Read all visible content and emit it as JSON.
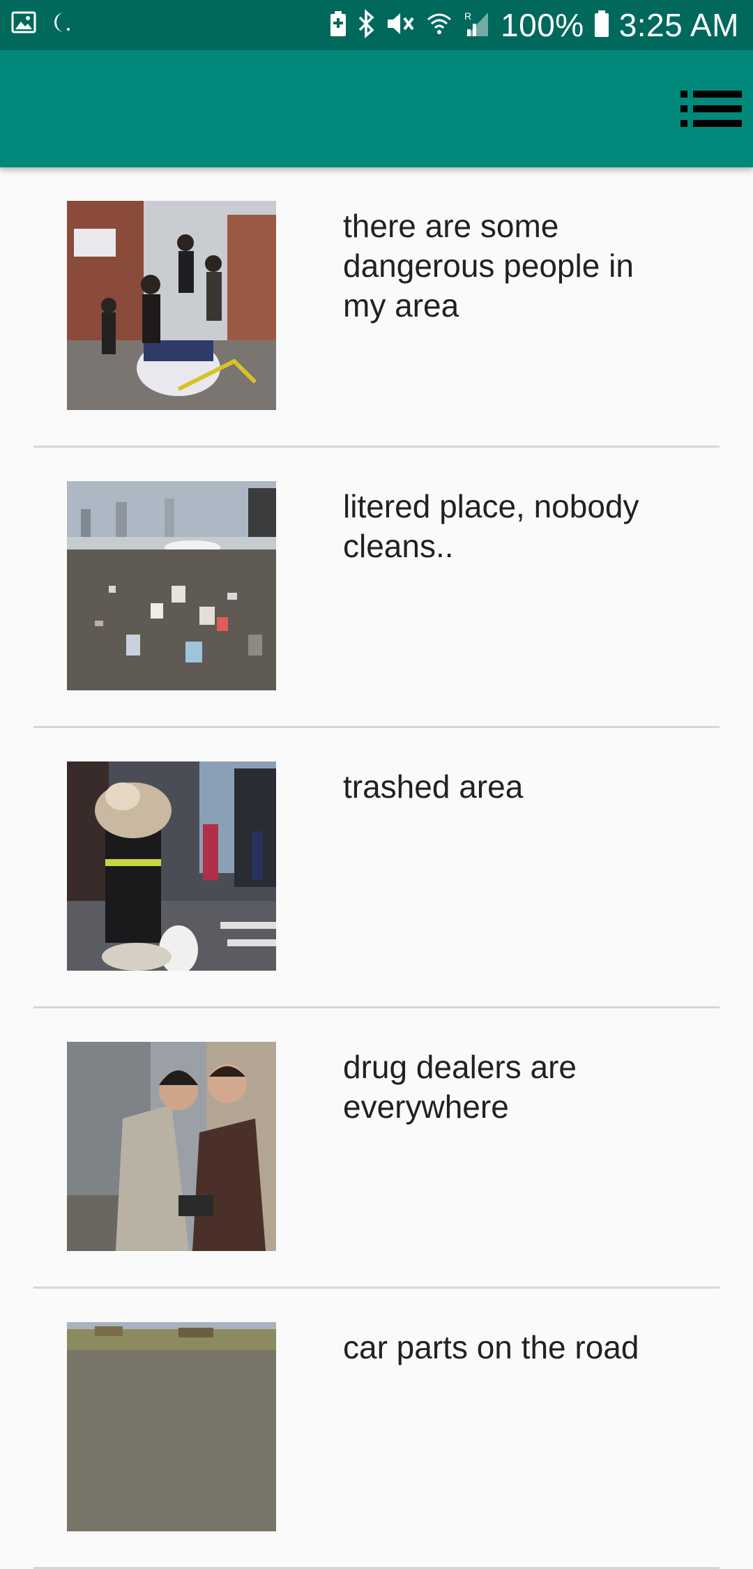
{
  "status_bar": {
    "battery_percent": "100%",
    "time": "3:25 AM",
    "icons": [
      "gallery-icon",
      "moon-icon",
      "battery-saver-icon",
      "bluetooth-icon",
      "vibrate-off-icon",
      "wifi-icon",
      "signal-icon",
      "battery-icon"
    ]
  },
  "app_bar": {
    "menu_icon": "list-menu-icon"
  },
  "colors": {
    "status_bar": "#00695c",
    "app_bar": "#00897b",
    "background": "#fafafa",
    "divider": "#d6d6d6",
    "text": "#212121"
  },
  "reports": [
    {
      "text": "there are some dangerous people in my area",
      "image": "street-crowd-police-car-photo"
    },
    {
      "text": "litered place, nobody cleans..",
      "image": "littered-harbor-photo"
    },
    {
      "text": "trashed area",
      "image": "overflowing-trash-bin-street-photo"
    },
    {
      "text": "drug dealers are everywhere",
      "image": "two-men-alley-photo"
    },
    {
      "text": "car parts on the road",
      "image": "roadside-car-parts-photo"
    }
  ]
}
